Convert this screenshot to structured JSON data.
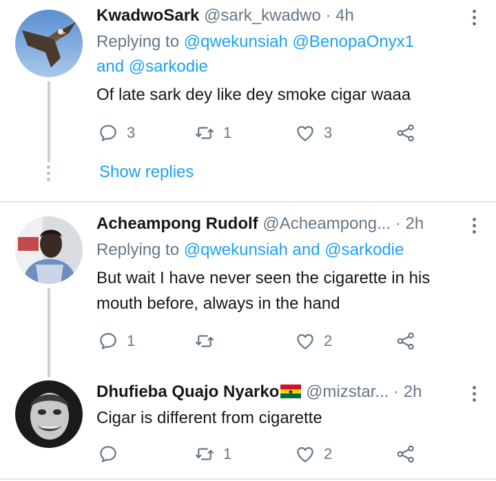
{
  "tweets": [
    {
      "name": "KwadwoSark",
      "handle": "@sark_kwadwo",
      "separator": "·",
      "time": "4h",
      "replying_prefix": "Replying to ",
      "mention1": "@qwekunsiah",
      "mention2": "@BenopaOnyx1",
      "and_word": "and",
      "mention3": "@sarkodie",
      "text": "Of late sark dey like dey smoke cigar waaa",
      "replies": "3",
      "retweets": "1",
      "likes": "3",
      "show_replies": "Show replies"
    },
    {
      "name": "Acheampong Rudolf",
      "handle": "@Acheampong...",
      "separator": "·",
      "time": "2h",
      "replying_prefix": "Replying to ",
      "mention1": "@qwekunsiah",
      "and_word": "and",
      "mention2": "@sarkodie",
      "text_line1": "But wait I have never seen the cigarette in his",
      "text_line2": "mouth before, always in the hand",
      "replies": "1",
      "retweets": "",
      "likes": "2"
    },
    {
      "name": "Dhufieba Quajo Nyarko",
      "handle": "@mizstar...",
      "separator": "·",
      "time": "2h",
      "text": "Cigar is different from cigarette",
      "replies": "",
      "retweets": "1",
      "likes": "2"
    }
  ],
  "icons": {
    "reply": "reply-icon",
    "retweet": "retweet-icon",
    "like": "heart-icon",
    "share": "share-icon",
    "more": "more-options-icon",
    "flag": "ghana-flag-emoji"
  },
  "colors": {
    "link": "#1da1f2",
    "secondary_text": "#657786",
    "thread_line": "#c9d1d9",
    "divider": "#e1e8ed"
  }
}
